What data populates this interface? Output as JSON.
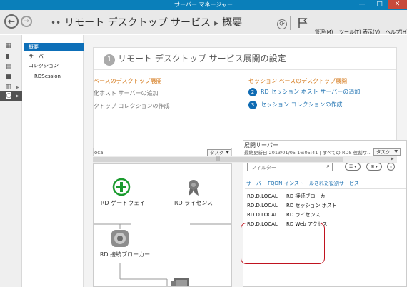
{
  "window": {
    "title": "サーバー マネージャー",
    "minimize": "—",
    "maximize": "□",
    "close": "✕"
  },
  "breadcrumb": {
    "prefix": "••",
    "root": "リモート デスクトップ サービス",
    "separator": "▸",
    "current": "概要"
  },
  "menu": {
    "manage": "管理(M)",
    "tools": "ツール(T)",
    "view": "表示(V)",
    "help": "ヘルプ(H)"
  },
  "left_icons": [
    {
      "icon": "dashboard-icon",
      "glyph": "▦"
    },
    {
      "icon": "local-server-icon",
      "glyph": "▮"
    },
    {
      "icon": "all-servers-icon",
      "glyph": "▤"
    },
    {
      "icon": "file-storage-icon",
      "glyph": "■"
    },
    {
      "icon": "file-services-icon",
      "glyph": "▥"
    },
    {
      "icon": "remote-desktop-icon",
      "glyph": "◙"
    }
  ],
  "nav": {
    "overview": "概要",
    "servers": "サーバー",
    "collections": "コレクション",
    "rdsession": "RDSession"
  },
  "deployment": {
    "step_number": "1",
    "heading": "リモート デスクトップ サービス展開の設定",
    "left_title": "ベースのデスクトップ展開",
    "left_item1": "化ホスト サーバーの追加",
    "left_item2": "クトップ コレクションの作成",
    "right_title": "セッション ベースのデスクトップ展開",
    "right_item1_num": "2",
    "right_item1": "RD セッション ホスト サーバーの追加",
    "right_item2_num": "3",
    "right_item2": "セッション コレクションの作成"
  },
  "overview": {
    "local_label": "ocal",
    "task_label": "タスク",
    "roles": {
      "gateway": "RD ゲートウェイ",
      "license": "RD ライセンス",
      "broker": "RD 接続ブローカー"
    }
  },
  "servers": {
    "title": "展開サーバー",
    "subtitle": "最終更新日 2013/01/05 16:05:41 | すべての RDS 役割サ...",
    "task_label": "タスク",
    "filter_placeholder": "フィルター",
    "col_fqdn": "サーバー FQDN",
    "col_role": "インストールされた役割サービス",
    "rows": [
      {
        "fqdn": "RD.D.LOCAL",
        "role": "RD 接続ブローカー"
      },
      {
        "fqdn": "RD.D.LOCAL",
        "role": "RD セッション ホスト"
      },
      {
        "fqdn": "RD.D.LOCAL",
        "role": "RD ライセンス"
      },
      {
        "fqdn": "RD.D.LOCAL",
        "role": "RD Web アクセス"
      }
    ]
  },
  "colors": {
    "titlebar": "#0a7fba",
    "selected_nav": "#0d6fb8",
    "orange_heading": "#d57a1c",
    "link_blue": "#1a6fb0",
    "highlight_red": "#c0131f",
    "gateway_green": "#1a9b2e"
  }
}
